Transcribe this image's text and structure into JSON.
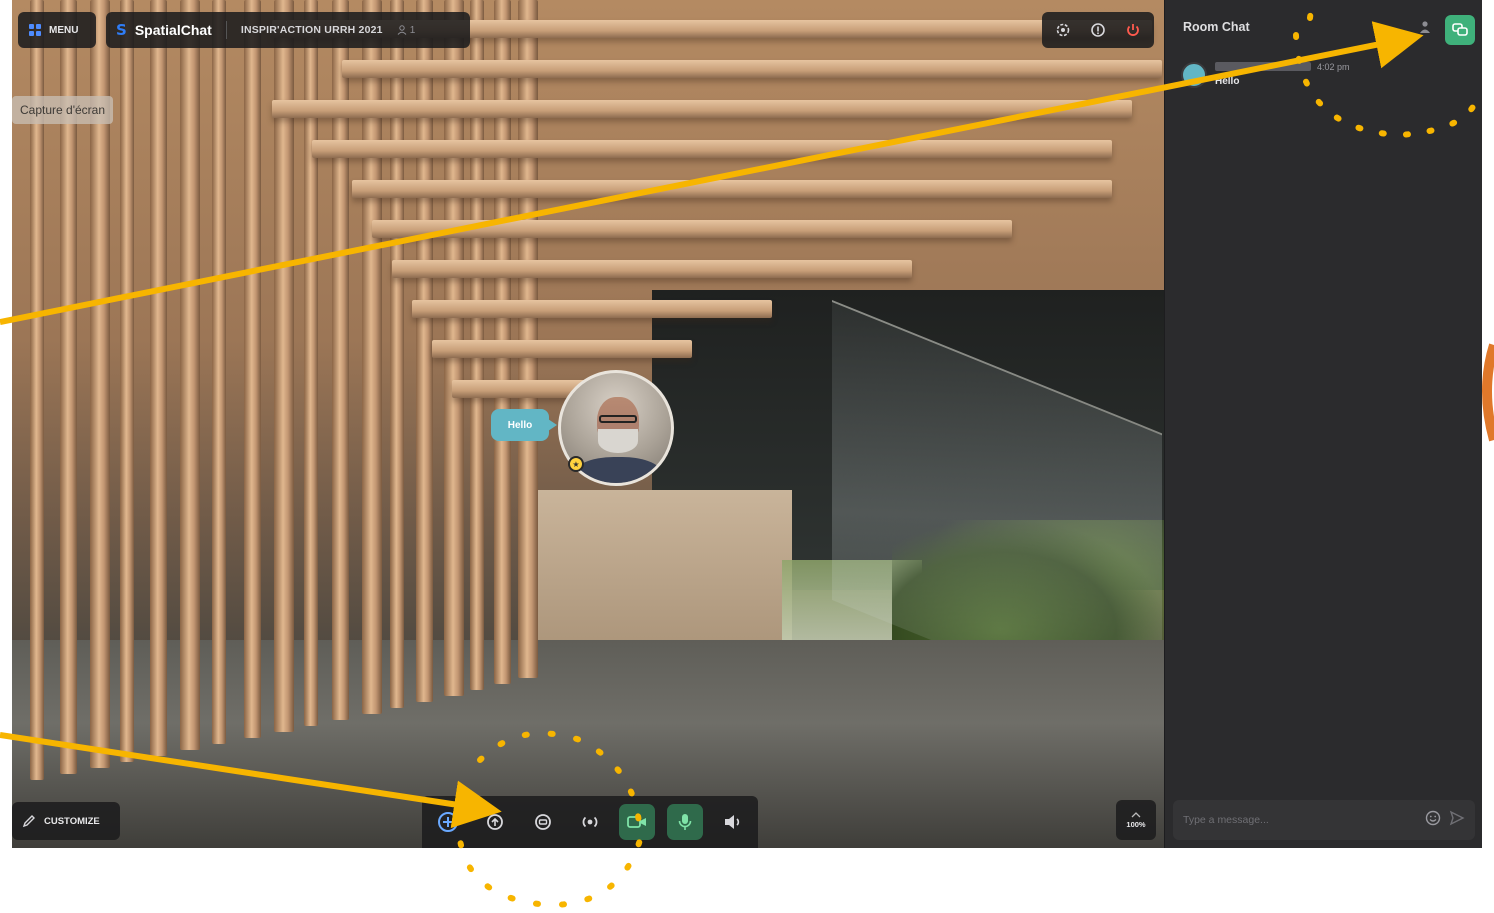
{
  "top_bar": {
    "menu_label": "MENU",
    "brand_name": "SpatialChat",
    "room_name": "INSPIR'ACTION URRH 2021",
    "user_count": "1"
  },
  "capture_tooltip": "Capture d'écran",
  "avatar": {
    "speech_text": "Hello"
  },
  "chat": {
    "title": "Room Chat",
    "messages": [
      {
        "time": "4:02 pm",
        "text": "Hello"
      }
    ],
    "input_placeholder": "Type a message..."
  },
  "bottom": {
    "customize_label": "CUSTOMIZE",
    "zoom_level": "100%"
  },
  "colors": {
    "accent_green": "#3fb17b",
    "bubble_teal": "#62b6c5",
    "annotation_yellow": "#f7b500",
    "annotation_orange": "#e0782a"
  },
  "icons": [
    "menu-grid-icon",
    "spatialchat-logo-icon",
    "person-icon",
    "settings-icon",
    "help-icon",
    "power-icon",
    "pencil-icon",
    "add-icon",
    "share-icon",
    "chat-icon",
    "broadcast-icon",
    "camera-icon",
    "microphone-icon",
    "speaker-icon",
    "emoji-icon",
    "send-icon"
  ]
}
